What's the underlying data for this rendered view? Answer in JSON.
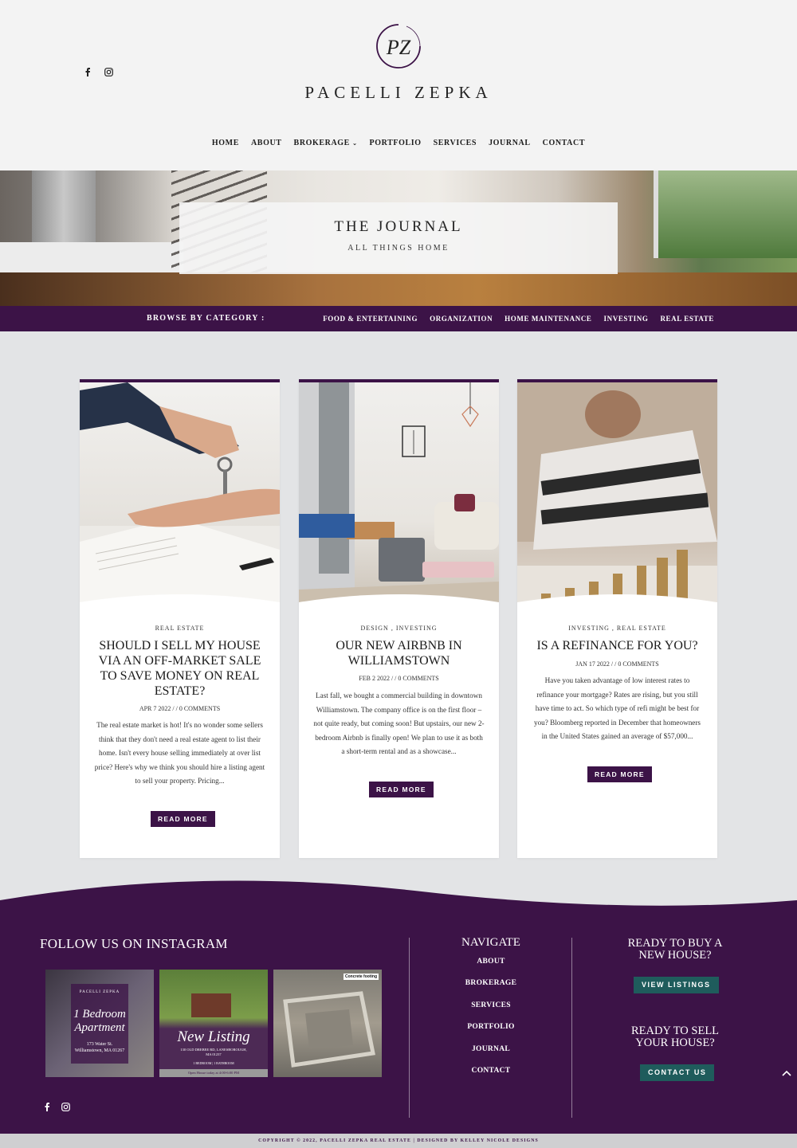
{
  "brand": {
    "name": "PACELLI ZEPKA",
    "monogram": "PZ"
  },
  "social": [
    {
      "name": "facebook-icon",
      "glyph": "f"
    },
    {
      "name": "instagram-icon",
      "glyph": "◎"
    }
  ],
  "nav": {
    "items": [
      "HOME",
      "ABOUT",
      "BROKERAGE",
      "PORTFOLIO",
      "SERVICES",
      "JOURNAL",
      "CONTACT"
    ],
    "dropdown_item": "BROKERAGE"
  },
  "hero": {
    "title": "THE JOURNAL",
    "subtitle": "ALL THINGS HOME"
  },
  "category_bar": {
    "label": "BROWSE BY CATEGORY :",
    "categories": [
      "FOOD & ENTERTAINING",
      "ORGANIZATION",
      "HOME MAINTENANCE",
      "INVESTING",
      "REAL ESTATE"
    ]
  },
  "posts": [
    {
      "category": "REAL ESTATE",
      "title": "SHOULD I SELL MY HOUSE VIA AN OFF-MARKET SALE TO SAVE MONEY ON REAL ESTATE?",
      "meta": "APR 7 2022 / / 0 COMMENTS",
      "excerpt": "The real estate market is hot! It's no wonder some sellers think that they don't need a real estate agent to list their home. Isn't every house selling immediately at over list price? Here's why we think you should hire a listing agent to sell your property. Pricing...",
      "button": "READ MORE"
    },
    {
      "category": "DESIGN , INVESTING",
      "title": "OUR NEW AIRBNB IN WILLIAMSTOWN",
      "meta": "FEB 2 2022 / / 0 COMMENTS",
      "excerpt": "Last fall, we bought a commercial building in downtown Williamstown. The company office is on the first floor – not quite ready, but coming soon! But upstairs, our new 2-bedroom Airbnb is finally open! We plan to use it as both a short-term rental and as a showcase...",
      "button": "READ MORE"
    },
    {
      "category": "INVESTING , REAL ESTATE",
      "title": "IS A REFINANCE FOR YOU?",
      "meta": "JAN 17 2022 / / 0 COMMENTS",
      "excerpt": "Have you taken advantage of low interest rates to refinance your mortgage? Rates are rising, but you still have time to act. So which type of refi might be best for you? Bloomberg reported in December that homeowners in the United States gained an average of $57,000...",
      "button": "READ MORE"
    }
  ],
  "footer": {
    "instagram_title": "FOLLOW US ON INSTAGRAM",
    "instagram_tiles": [
      {
        "script": "1 Bedroom Apartment",
        "caption": "173 Water St. Williamstown, MA 01267",
        "brand": "PACELLI ZEPKA"
      },
      {
        "script": "New Listing",
        "caption": "130 OLD DREBEE RD, LANESBOROUGH, MA 01237",
        "detail": "1 BEDROOM | 1 BATHROOM",
        "banner": "Open House today at 4:00-6:00 PM"
      },
      {
        "label": "Concrete footing"
      }
    ],
    "navigate_title": "NAVIGATE",
    "navigate_items": [
      "ABOUT",
      "BROKERAGE",
      "SERVICES",
      "PORTFOLIO",
      "JOURNAL",
      "CONTACT"
    ],
    "buy_title": "READY TO BUY A NEW HOUSE?",
    "buy_button": "VIEW LISTINGS",
    "sell_title": "READY TO SELL YOUR HOUSE?",
    "sell_button": "CONTACT US",
    "copyright": "COPYRIGHT © 2022, PACELLI ZEPKA REAL ESTATE | DESIGNED BY KELLEY NICOLE DESIGNS"
  },
  "colors": {
    "accent": "#3c1347",
    "teal": "#1f5c5c",
    "background": "#e3e4e6"
  }
}
